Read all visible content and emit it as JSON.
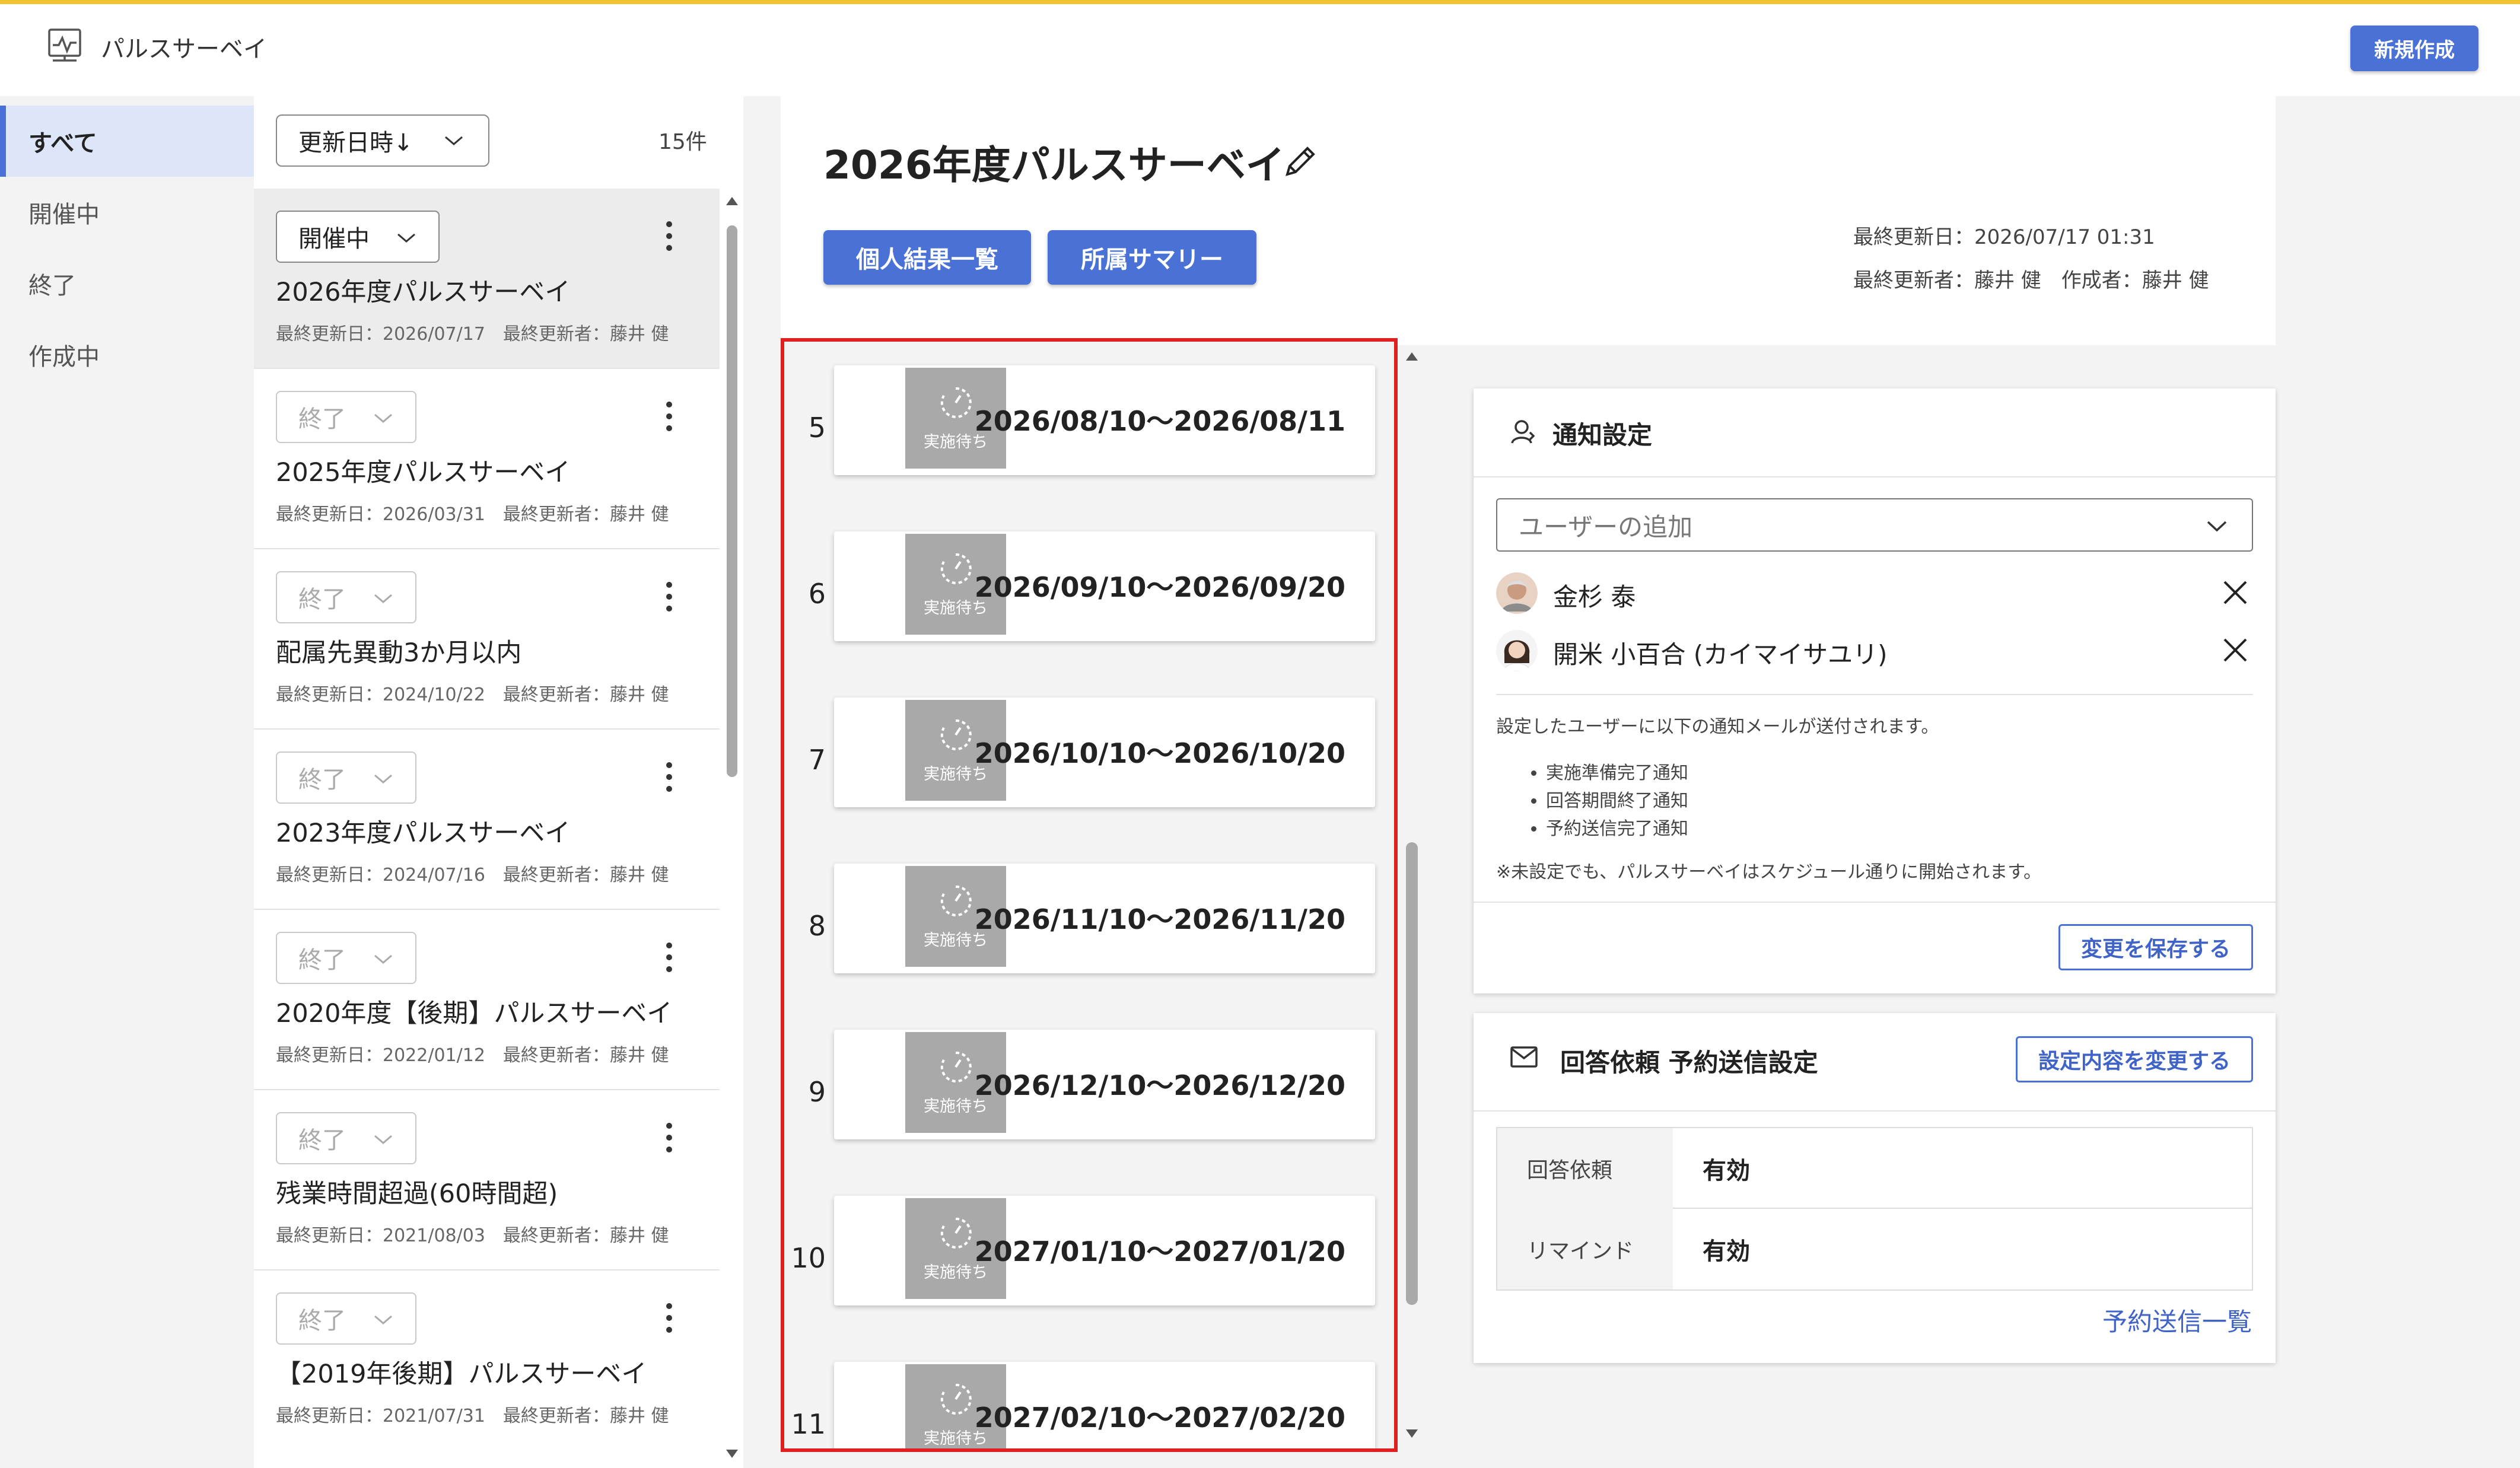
{
  "app": {
    "title": "パルスサーベイ",
    "new_button": "新規作成"
  },
  "nav": {
    "items": [
      {
        "label": "すべて",
        "active": true
      },
      {
        "label": "開催中",
        "active": false
      },
      {
        "label": "終了",
        "active": false
      },
      {
        "label": "作成中",
        "active": false
      }
    ]
  },
  "list": {
    "sort_label": "更新日時↓",
    "count": "15件",
    "surveys": [
      {
        "status": "開催中",
        "title": "2026年度パルスサーベイ",
        "meta": "最終更新日：2026/07/17　最終更新者：藤井 健"
      },
      {
        "status": "終了",
        "title": "2025年度パルスサーベイ",
        "meta": "最終更新日：2026/03/31　最終更新者：藤井 健"
      },
      {
        "status": "終了",
        "title": "配属先異動3か月以内",
        "meta": "最終更新日：2024/10/22　最終更新者：藤井 健"
      },
      {
        "status": "終了",
        "title": "2023年度パルスサーベイ",
        "meta": "最終更新日：2024/07/16　最終更新者：藤井 健"
      },
      {
        "status": "終了",
        "title": "2020年度【後期】パルスサーベイ",
        "meta": "最終更新日：2022/01/12　最終更新者：藤井 健"
      },
      {
        "status": "終了",
        "title": "残業時間超過(60時間超)",
        "meta": "最終更新日：2021/08/03　最終更新者：藤井 健"
      },
      {
        "status": "終了",
        "title": "【2019年後期】パルスサーベイ",
        "meta": "最終更新日：2021/07/31　最終更新者：藤井 健"
      }
    ]
  },
  "detail": {
    "title": "2026年度パルスサーベイ",
    "buttons": {
      "results": "個人結果一覧",
      "summary": "所属サマリー"
    },
    "last_updated": "最終更新日：2026/07/17 01:31",
    "updaters": "最終更新者：藤井 健　作成者：藤井 健"
  },
  "schedule": {
    "badge_label": "実施待ち",
    "rows": [
      {
        "num": "5",
        "range": "2026/08/10～2026/08/11"
      },
      {
        "num": "6",
        "range": "2026/09/10～2026/09/20"
      },
      {
        "num": "7",
        "range": "2026/10/10～2026/10/20"
      },
      {
        "num": "8",
        "range": "2026/11/10～2026/11/20"
      },
      {
        "num": "9",
        "range": "2026/12/10～2026/12/20"
      },
      {
        "num": "10",
        "range": "2027/01/10～2027/01/20"
      },
      {
        "num": "11",
        "range": "2027/02/10～2027/02/20"
      }
    ]
  },
  "notify": {
    "title": "通知設定",
    "add_user_placeholder": "ユーザーの追加",
    "users": [
      {
        "name": "金杉 泰"
      },
      {
        "name": "開米 小百合 (カイマイサユリ)"
      }
    ],
    "description": "設定したユーザーに以下の通知メールが送付されます。",
    "items": [
      "実施準備完了通知",
      "回答期間終了通知",
      "予約送信完了通知"
    ],
    "note": "※未設定でも、パルスサーベイはスケジュール通りに開始されます。",
    "save_button": "変更を保存する"
  },
  "reserve": {
    "title": "回答依頼 予約送信設定",
    "change_button": "設定内容を変更する",
    "rows": [
      {
        "label": "回答依頼",
        "value": "有効"
      },
      {
        "label": "リマインド",
        "value": "有効"
      }
    ],
    "link": "予約送信一覧"
  }
}
